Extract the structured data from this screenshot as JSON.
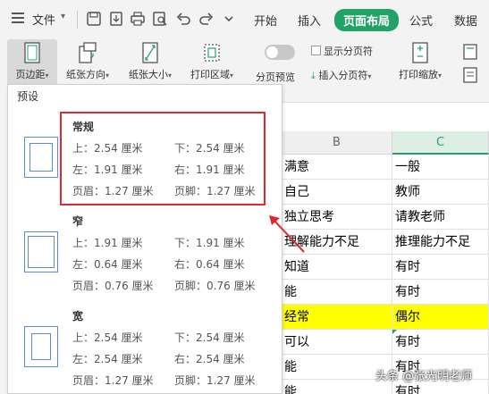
{
  "menubar": {
    "file_label": "文件",
    "tabs": [
      "开始",
      "插入",
      "页面布局",
      "公式",
      "数据"
    ],
    "active_tab": "页面布局",
    "accent_color": "#21a366"
  },
  "ribbon": {
    "margins_label": "页边距",
    "orientation_label": "纸张方向",
    "size_label": "纸张大小",
    "print_area_label": "打印区域",
    "page_break_preview_label": "分页预览",
    "show_page_breaks_label": "显示分页符",
    "insert_page_break_label": "插入分页符",
    "print_scale_label": "打印缩放"
  },
  "panel": {
    "title": "预设",
    "presets": [
      {
        "name": "常规",
        "top": "上：2.54 厘米",
        "bottom": "下：2.54 厘米",
        "left": "左：1.91 厘米",
        "right": "右：1.91 厘米",
        "header": "页眉：1.27 厘米",
        "footer": "页脚：1.27 厘米"
      },
      {
        "name": "窄",
        "top": "上：1.91 厘米",
        "bottom": "下：1.91 厘米",
        "left": "左：0.64 厘米",
        "right": "右：0.64 厘米",
        "header": "页眉：0.76 厘米",
        "footer": "页脚：0.76 厘米"
      },
      {
        "name": "宽",
        "top": "上：2.54 厘米",
        "bottom": "下：2.54 厘米",
        "left": "左：2.54 厘米",
        "right": "右：2.54 厘米",
        "header": "页眉：1.27 厘米",
        "footer": "页脚：1.27 厘米"
      }
    ],
    "highlight_color": "#e0282d"
  },
  "sheet": {
    "columns": [
      "B",
      "C"
    ],
    "rows": [
      [
        "满意",
        "一般"
      ],
      [
        "自己",
        "教师"
      ],
      [
        "独立思考",
        "请教老师"
      ],
      [
        "理解能力不足",
        "推理能力不足"
      ],
      [
        "知道",
        "有时"
      ],
      [
        "能",
        "有时"
      ],
      [
        "经常",
        "偶尔"
      ],
      [
        "可以",
        "有时"
      ],
      [
        "能",
        "有时"
      ],
      [
        "能",
        "有时"
      ]
    ],
    "highlight_row_color": "#ffff00"
  },
  "watermark": "头条 @张光明老师"
}
